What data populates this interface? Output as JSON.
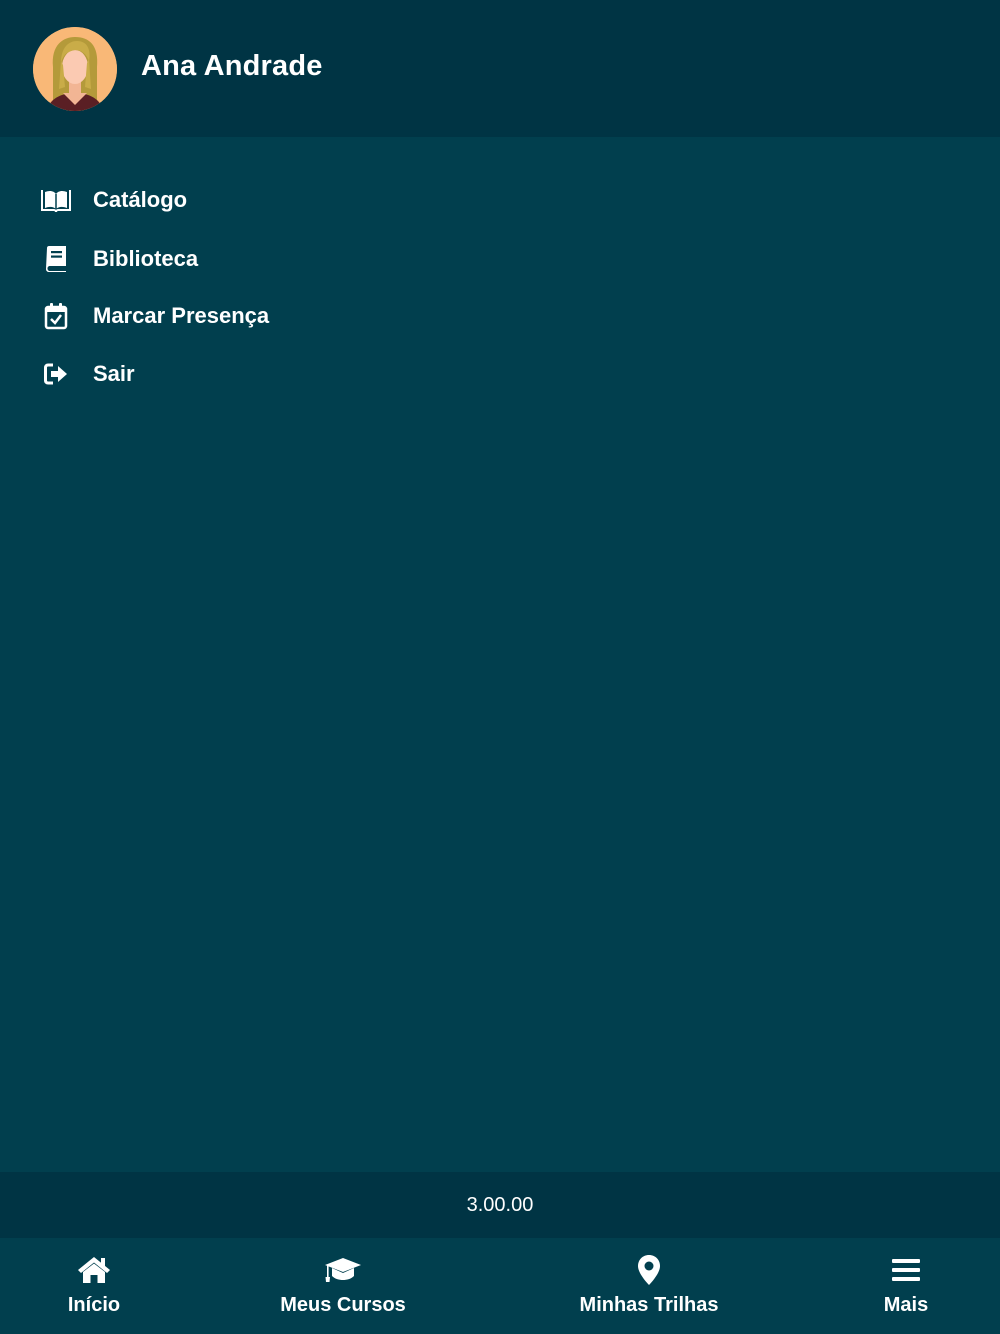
{
  "header": {
    "user_name": "Ana Andrade",
    "avatar_icon": "user-avatar-female"
  },
  "menu": {
    "items": [
      {
        "label": "Catálogo",
        "icon": "open-book-icon"
      },
      {
        "label": "Biblioteca",
        "icon": "book-icon"
      },
      {
        "label": "Marcar Presença",
        "icon": "calendar-check-icon"
      },
      {
        "label": "Sair",
        "icon": "sign-out-icon"
      }
    ]
  },
  "footer": {
    "version": "3.00.00"
  },
  "tabbar": {
    "tabs": [
      {
        "label": "Início",
        "icon": "home-icon"
      },
      {
        "label": "Meus Cursos",
        "icon": "graduation-cap-icon"
      },
      {
        "label": "Minhas Trilhas",
        "icon": "map-pin-icon"
      },
      {
        "label": "Mais",
        "icon": "hamburger-menu-icon"
      }
    ]
  },
  "colors": {
    "background": "#013f4e",
    "header_background": "#003444",
    "text": "#ffffff",
    "avatar_background": "#f9b877"
  }
}
